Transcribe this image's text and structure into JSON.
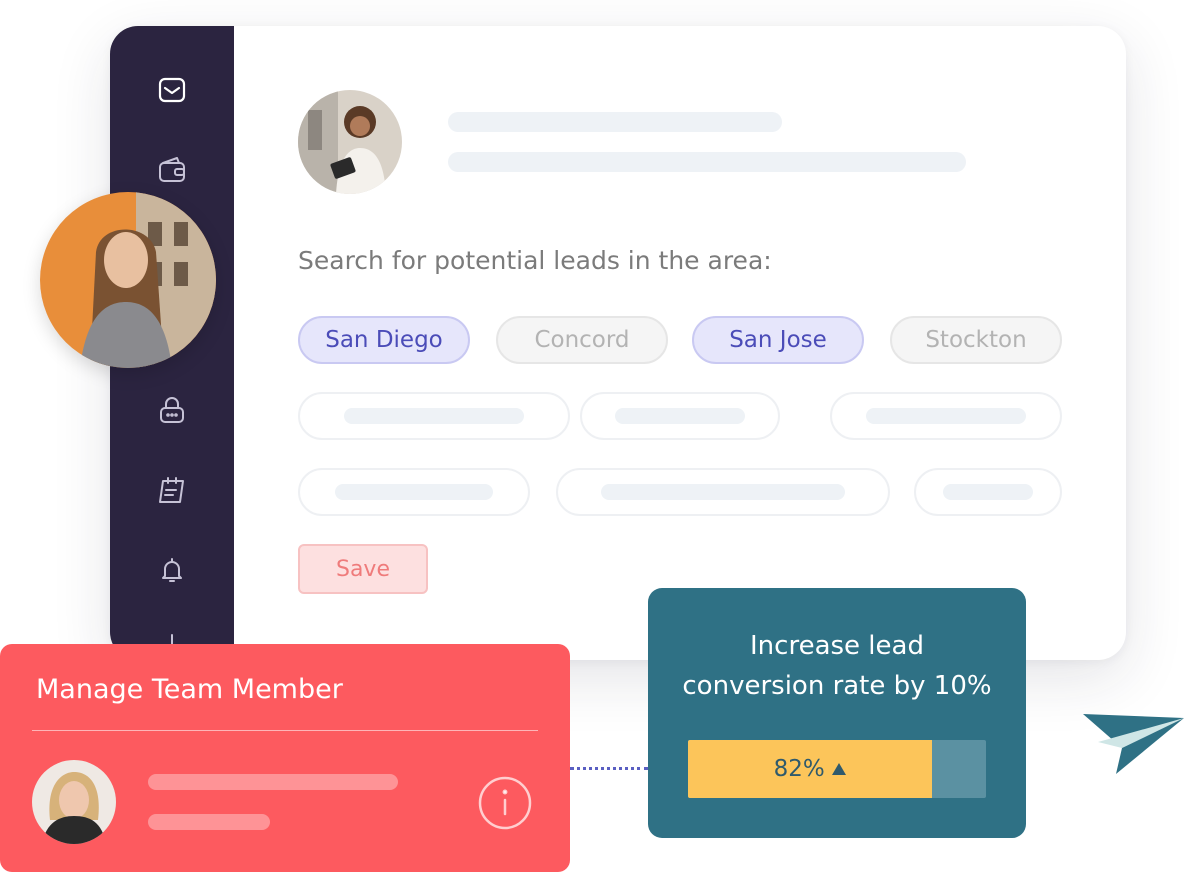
{
  "sidebar": {
    "icons": [
      "inbox-icon",
      "wallet-icon",
      "user-icon",
      "lock-icon",
      "calendar-icon",
      "bell-icon"
    ]
  },
  "search": {
    "prompt": "Search for potential leads in the area:",
    "chips": [
      {
        "label": "San Diego",
        "selected": true
      },
      {
        "label": "Concord",
        "selected": false
      },
      {
        "label": "San Jose",
        "selected": true
      },
      {
        "label": "Stockton",
        "selected": false
      }
    ],
    "save_label": "Save"
  },
  "manage": {
    "title": "Manage Team Member"
  },
  "goal": {
    "line1": "Increase lead",
    "line2": "conversion rate by 10%",
    "progress_label": "82%",
    "progress_value": 0.82,
    "trend_icon": "up-triangle-icon"
  },
  "colors": {
    "sidebar": "#2b2440",
    "chip_selected_text": "#4b4cb8",
    "save_text": "#ef7b7b",
    "manage_bg": "#fd5a5f",
    "goal_bg": "#2f7185",
    "progress_fill": "#fcc55a"
  }
}
